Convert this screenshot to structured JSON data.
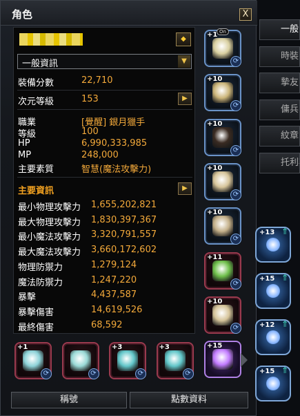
{
  "window": {
    "title": "角色",
    "close_label": "X"
  },
  "character": {
    "view_selector": "一般資訊",
    "gear_score_label": "裝備分數",
    "gear_score": "22,710",
    "dimension_level_label": "次元等級",
    "dimension_level": "153",
    "class_label": "職業",
    "class_value": "[覺醒] 銀月獵手",
    "level_label": "等級",
    "level_value": "100",
    "hp_label": "HP",
    "hp_value": "6,990,333,985",
    "mp_label": "MP",
    "mp_value": "248,000",
    "main_stat_label": "主要素質",
    "main_stat_value": "智慧(魔法攻擊力)"
  },
  "main_info": {
    "title": "主要資訊",
    "stats": [
      {
        "label": "最小物理攻擊力",
        "value": "1,655,202,821"
      },
      {
        "label": "最大物理攻擊力",
        "value": "1,830,397,367"
      },
      {
        "label": "最小魔法攻擊力",
        "value": "3,320,791,557"
      },
      {
        "label": "最大魔法攻擊力",
        "value": "3,660,172,602"
      },
      {
        "label": "物理防禦力",
        "value": "1,279,124"
      },
      {
        "label": "魔法防禦力",
        "value": "1,247,220"
      },
      {
        "label": "暴擊",
        "value": "4,437,587"
      },
      {
        "label": "暴擊傷害",
        "value": "14,619,526"
      },
      {
        "label": "最終傷害",
        "value": "68,592"
      }
    ]
  },
  "equipment_right": [
    {
      "level": "+1",
      "badge": "On",
      "icon": "helmet-icon",
      "color": "#d8cfa0"
    },
    {
      "level": "+10",
      "icon": "chest-armor-icon",
      "color": "#cbb57a"
    },
    {
      "level": "+10",
      "icon": "pants-icon",
      "color": "#3a2b22"
    },
    {
      "level": "+10",
      "icon": "glove-icon",
      "color": "#d6c49a"
    },
    {
      "level": "+10",
      "icon": "boots-icon",
      "color": "#c4b08a"
    },
    {
      "level": "+11",
      "icon": "weapon-icon",
      "color": "#6fbf4b"
    },
    {
      "level": "+10",
      "icon": "offhand-icon",
      "color": "#d6c49a"
    },
    {
      "level": "+15",
      "icon": "crystal-icon",
      "color": "#c27cff"
    }
  ],
  "equipment_bottom": [
    {
      "level": "+1",
      "icon": "necklace-icon",
      "color": "#8ed2d8"
    },
    {
      "level": "",
      "icon": "earring-icon",
      "color": "#9ad9d6"
    },
    {
      "level": "+3",
      "icon": "ring-icon",
      "color": "#62c6c9"
    },
    {
      "level": "+3",
      "icon": "ring-icon",
      "color": "#62c6c9"
    }
  ],
  "seals": [
    {
      "level": "+13"
    },
    {
      "level": "+15"
    },
    {
      "level": "+12"
    },
    {
      "level": "+15"
    }
  ],
  "right_tabs": [
    "一般",
    "時裝",
    "摯友",
    "傭兵",
    "紋章",
    "托利斯"
  ],
  "bottom_buttons": {
    "title_label": "稱號",
    "points_label": "點數資料"
  }
}
